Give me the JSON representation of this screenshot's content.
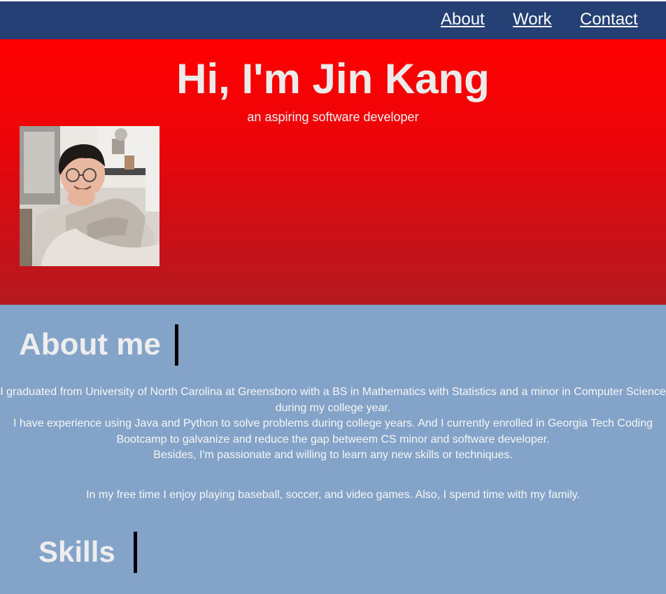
{
  "nav": {
    "about": "About",
    "work": "Work",
    "contact": "Contact"
  },
  "hero": {
    "title": "Hi, I'm Jin Kang",
    "subtitle": "an aspiring software developer"
  },
  "about": {
    "heading": "About me",
    "paragraph_lines": [
      "I graduated from University of North Carolina at Greensboro with a BS in Mathematics with Statistics and a minor in Computer Science",
      "during my college year.",
      "I have experience using Java and Python to solve problems during college years. And I currently enrolled in Georgia Tech Coding",
      "Bootcamp to galvanize and reduce the gap betweem CS minor and software developer.",
      "Besides, I'm passionate and willing to learn any new skills or techniques."
    ],
    "free_time": "In my free time I enjoy playing baseball, soccer, and video games. Also, I spend time with my family."
  },
  "skills": {
    "heading": "Skills"
  },
  "colors": {
    "nav_bg": "#244074",
    "hero_top": "#ff0000",
    "hero_bottom": "#b31a1f",
    "page_bg": "#83a3c8",
    "heading_text": "#ededed",
    "accent_bar": "#000000"
  }
}
